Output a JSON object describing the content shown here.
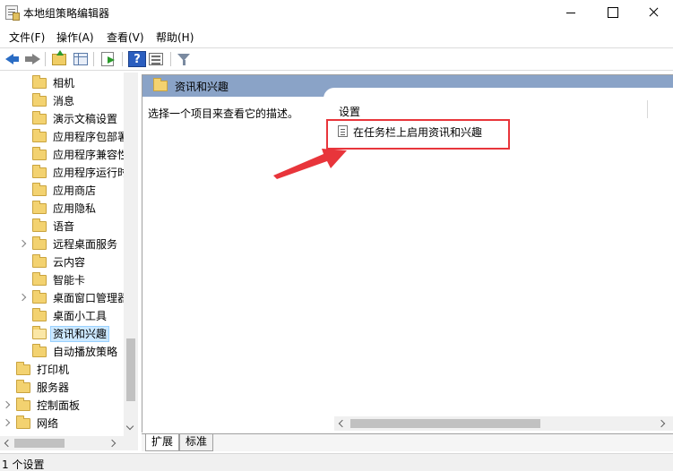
{
  "window": {
    "title": "本地组策略编辑器"
  },
  "menu": {
    "items": [
      {
        "label": "文件(F)"
      },
      {
        "label": "操作(A)"
      },
      {
        "label": "查看(V)"
      },
      {
        "label": "帮助(H)"
      }
    ]
  },
  "toolbar": {
    "icons": [
      "back-arrow-icon",
      "forward-arrow-icon",
      "up-folder-icon",
      "show-hide-tree-icon",
      "export-list-icon",
      "help-icon",
      "view-icon",
      "filter-icon"
    ],
    "help_glyph": "?"
  },
  "tree": {
    "items": [
      {
        "label": "相机",
        "indent": 1,
        "expandable": false,
        "selected": false
      },
      {
        "label": "消息",
        "indent": 1,
        "expandable": false,
        "selected": false
      },
      {
        "label": "演示文稿设置",
        "indent": 1,
        "expandable": false,
        "selected": false
      },
      {
        "label": "应用程序包部署",
        "indent": 1,
        "expandable": false,
        "selected": false
      },
      {
        "label": "应用程序兼容性",
        "indent": 1,
        "expandable": false,
        "selected": false
      },
      {
        "label": "应用程序运行时",
        "indent": 1,
        "expandable": false,
        "selected": false
      },
      {
        "label": "应用商店",
        "indent": 1,
        "expandable": false,
        "selected": false
      },
      {
        "label": "应用隐私",
        "indent": 1,
        "expandable": false,
        "selected": false
      },
      {
        "label": "语音",
        "indent": 1,
        "expandable": false,
        "selected": false
      },
      {
        "label": "远程桌面服务",
        "indent": 1,
        "expandable": true,
        "selected": false
      },
      {
        "label": "云内容",
        "indent": 1,
        "expandable": false,
        "selected": false
      },
      {
        "label": "智能卡",
        "indent": 1,
        "expandable": false,
        "selected": false
      },
      {
        "label": "桌面窗口管理器",
        "indent": 1,
        "expandable": true,
        "selected": false
      },
      {
        "label": "桌面小工具",
        "indent": 1,
        "expandable": false,
        "selected": false
      },
      {
        "label": "资讯和兴趣",
        "indent": 1,
        "expandable": false,
        "selected": true
      },
      {
        "label": "自动播放策略",
        "indent": 1,
        "expandable": false,
        "selected": false
      },
      {
        "label": "打印机",
        "indent": 0,
        "expandable": false,
        "selected": false
      },
      {
        "label": "服务器",
        "indent": 0,
        "expandable": false,
        "selected": false
      },
      {
        "label": "控制面板",
        "indent": 0,
        "expandable": true,
        "selected": false
      },
      {
        "label": "网络",
        "indent": 0,
        "expandable": true,
        "selected": false
      }
    ],
    "vertical_scroll_fraction": 0.76
  },
  "details": {
    "header_title": "资讯和兴趣",
    "description": "选择一个项目来查看它的描述。",
    "settings_column": "设置",
    "policies": [
      {
        "label": "在任务栏上启用资讯和兴趣"
      }
    ],
    "highlight_color": "#e8353b",
    "header_color": "#8aa3c7"
  },
  "tabs": [
    {
      "label": "扩展",
      "active": true
    },
    {
      "label": "标准",
      "active": false
    }
  ],
  "status": {
    "text": "1 个设置"
  }
}
